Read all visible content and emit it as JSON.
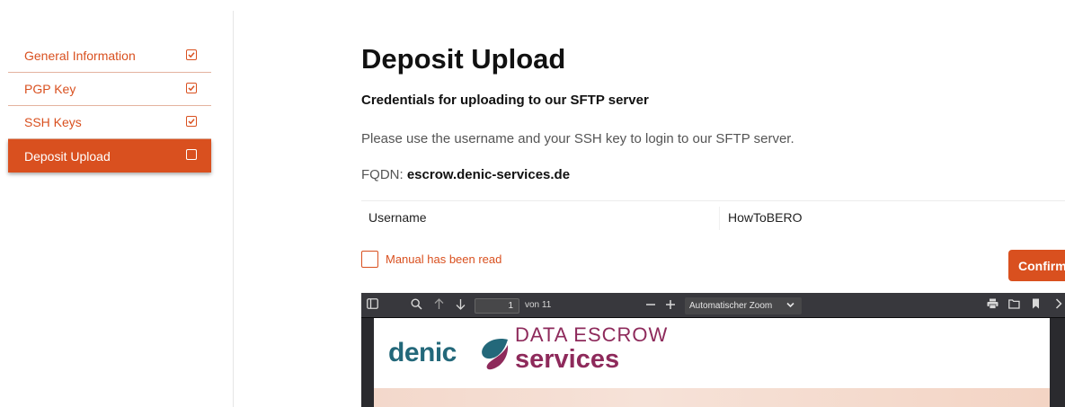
{
  "sidebar": {
    "items": [
      {
        "label": "General Information",
        "checked": true,
        "active": false
      },
      {
        "label": "PGP Key",
        "checked": true,
        "active": false
      },
      {
        "label": "SSH Keys",
        "checked": true,
        "active": false
      },
      {
        "label": "Deposit Upload",
        "checked": false,
        "active": true
      }
    ]
  },
  "main": {
    "title": "Deposit Upload",
    "subtitle": "Credentials for uploading to our SFTP server",
    "instructions": "Please use the username and your SSH key to login to our SFTP server.",
    "fqdn_label": "FQDN: ",
    "fqdn_value": "escrow.denic-services.de",
    "credentials": {
      "username_label": "Username",
      "username_value": "HowToBERO"
    },
    "manual_checkbox_label": "Manual has been read",
    "confirm_label": "Confirm"
  },
  "pdf_viewer": {
    "page_number": "1",
    "page_of": "von 11",
    "zoom": "Automatischer Zoom",
    "logo_word": "denic",
    "logo_top": "DATA ESCROW",
    "logo_bottom": "services"
  },
  "colors": {
    "accent": "#d9501f",
    "logo_teal": "#23687a",
    "logo_plum": "#8e2a5b",
    "viewer_toolbar": "#38383d"
  }
}
